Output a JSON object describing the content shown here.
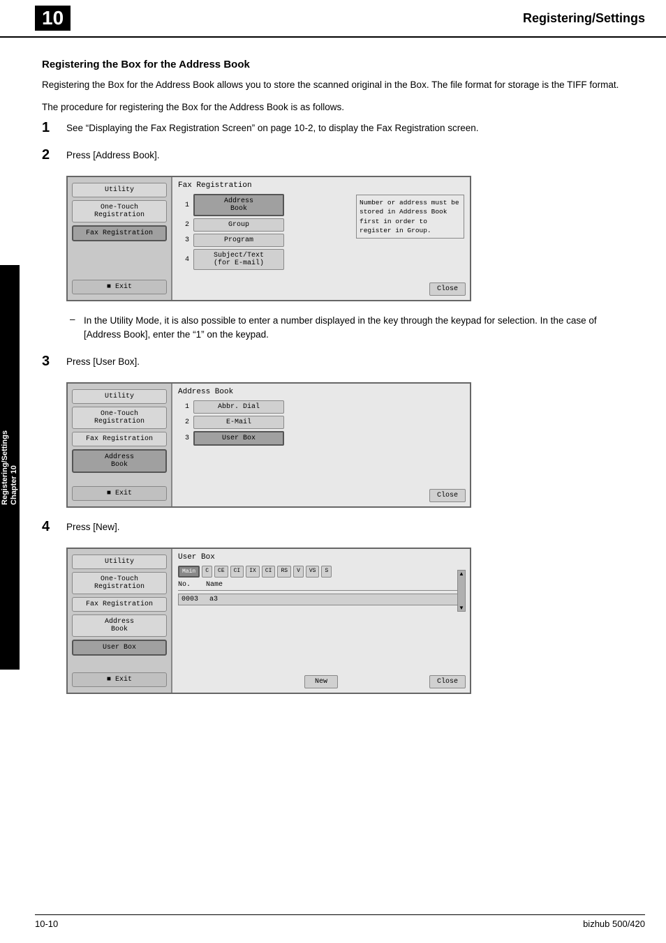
{
  "header": {
    "chapter_num": "10",
    "title": "Registering/Settings"
  },
  "side_tab": {
    "top": "Registering/Settings",
    "bottom": "Chapter 10"
  },
  "section": {
    "title": "Registering the Box for the Address Book",
    "para1": "Registering the Box for the Address Book allows you to store the scanned original in the Box. The file format for storage is the TIFF format.",
    "para2": "The procedure for registering the Box for the Address Book is as follows."
  },
  "steps": [
    {
      "num": "1",
      "text": "See “Displaying the Fax Registration Screen” on page 10-2, to display the Fax Registration screen."
    },
    {
      "num": "2",
      "text": "Press [Address Book]."
    },
    {
      "num": "3",
      "text": "Press [User Box]."
    },
    {
      "num": "4",
      "text": "Press [New]."
    }
  ],
  "dash_note": "In the Utility Mode, it is also possible to enter a number displayed in the key through the keypad for selection. In the case of [Address Book], enter the “1” on the keypad.",
  "screen1": {
    "title": "Fax Registration",
    "sidebar_items": [
      "Utility",
      "One-Touch\nRegistration",
      "Fax Registration"
    ],
    "menu_items": [
      {
        "num": "1",
        "label": "Address\nBook",
        "highlighted": true
      },
      {
        "num": "2",
        "label": "Group"
      },
      {
        "num": "3",
        "label": "Program"
      },
      {
        "num": "4",
        "label": "Subject/Text\n(for E-mail)"
      }
    ],
    "note": "Number or address must be stored in Address Book first in order to register in Group.",
    "close_label": "Close",
    "exit_label": "Exit"
  },
  "screen2": {
    "title": "Address Book",
    "sidebar_items": [
      "Utility",
      "One-Touch\nRegistration",
      "Fax Registration",
      "Address\nBook"
    ],
    "menu_items": [
      {
        "num": "1",
        "label": "Abbr. Dial"
      },
      {
        "num": "2",
        "label": "E-Mail"
      },
      {
        "num": "3",
        "label": "User Box",
        "highlighted": true
      }
    ],
    "close_label": "Close",
    "exit_label": "Exit"
  },
  "screen3": {
    "title": "User Box",
    "sidebar_items": [
      "Utility",
      "One-Touch\nRegistration",
      "Fax Registration",
      "Address\nBook",
      "User Box"
    ],
    "tabs": [
      "Main",
      "C",
      "CE",
      "CI",
      "IX",
      "CI",
      "RS",
      "V",
      "VS",
      "S"
    ],
    "active_tab": "Main",
    "columns": [
      "No.",
      "Name"
    ],
    "rows": [
      {
        "no": "0003",
        "name": "a3"
      }
    ],
    "new_label": "New",
    "close_label": "Close",
    "exit_label": "Exit"
  },
  "footer": {
    "page": "10-10",
    "brand": "bizhub 500/420"
  }
}
